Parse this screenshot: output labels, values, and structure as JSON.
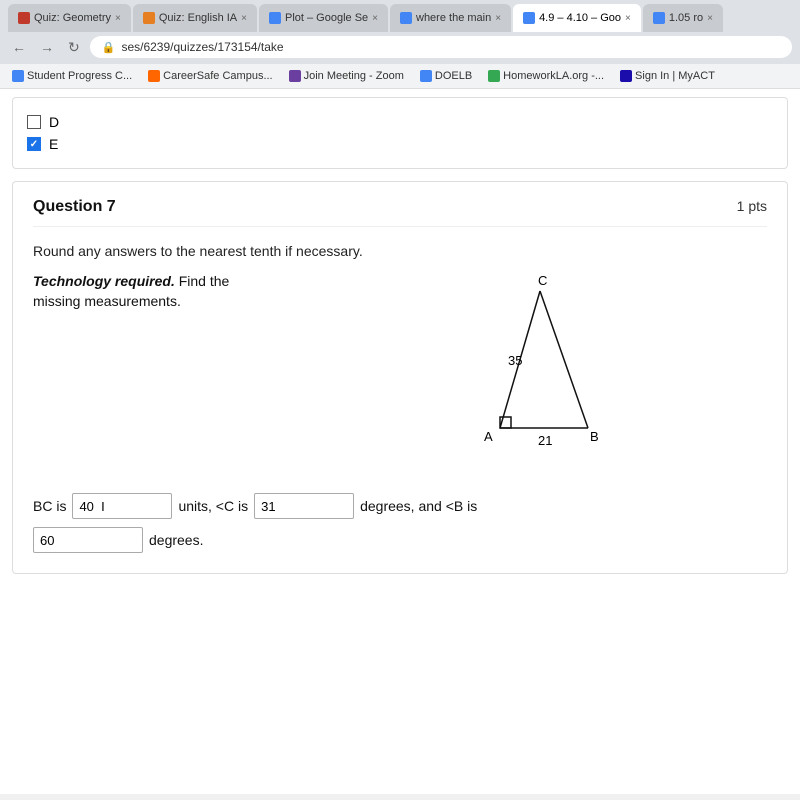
{
  "browser": {
    "tabs": [
      {
        "id": "tab1",
        "label": "Quiz: Geometry",
        "active": false,
        "favicon_color": "#c0392b"
      },
      {
        "id": "tab2",
        "label": "Quiz: English IA",
        "active": false,
        "favicon_color": "#e67e22"
      },
      {
        "id": "tab3",
        "label": "Plot – Google Se",
        "active": false,
        "favicon_color": "#4285f4"
      },
      {
        "id": "tab4",
        "label": "where the main",
        "active": false,
        "favicon_color": "#4285f4"
      },
      {
        "id": "tab5",
        "label": "4.9 – 4.10 – Goo",
        "active": true,
        "favicon_color": "#4285f4"
      },
      {
        "id": "tab6",
        "label": "1.05 ro",
        "active": false,
        "favicon_color": "#4285f4"
      }
    ],
    "url": "ses/6239/quizzes/173154/take",
    "bookmarks": [
      {
        "label": "Student Progress C...",
        "icon_color": "#4285f4"
      },
      {
        "label": "CareerSafe Campus...",
        "icon_color": "#e67e22"
      },
      {
        "label": "Join Meeting - Zoom",
        "icon_color": "#2d8cff"
      },
      {
        "label": "DOELB",
        "icon_color": "#4285f4"
      },
      {
        "label": "HomeworkLA.org -...",
        "icon_color": "#34a853"
      },
      {
        "label": "Sign In | MyACT",
        "icon_color": "#c0392b"
      }
    ]
  },
  "prev_question_tail": {
    "option_d": {
      "label": "D",
      "checked": false
    },
    "option_e": {
      "label": "E",
      "checked": true
    }
  },
  "question": {
    "number": "Question 7",
    "pts": "1 pts",
    "instructions": "Round any answers to the nearest tenth if necessary.",
    "tech_label": "Technology required.",
    "find_label": " Find the",
    "missing_label": "missing measurements.",
    "triangle": {
      "label_c": "C",
      "label_a": "A",
      "label_b": "B",
      "side_ca": "35",
      "side_ab": "21",
      "right_angle_at": "A"
    },
    "answer_bc_label": "BC is",
    "answer_bc_value": "40",
    "answer_bc_suffix": "I",
    "answer_bc_units": "units, <C is",
    "answer_c_value": "31",
    "answer_c_suffix": "degrees, and <B is",
    "answer_b_value": "60",
    "answer_b_suffix": "degrees."
  }
}
